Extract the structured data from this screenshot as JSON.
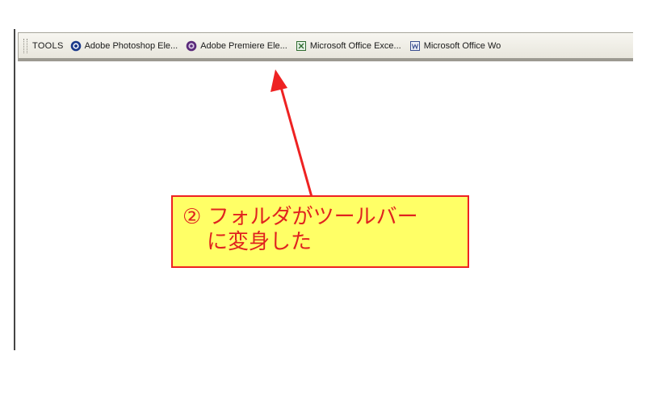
{
  "toolbar": {
    "label": "TOOLS",
    "items": [
      {
        "label": "Adobe Photoshop Ele...",
        "icon": "photoshop-elements-icon"
      },
      {
        "label": "Adobe Premiere Ele...",
        "icon": "premiere-elements-icon"
      },
      {
        "label": "Microsoft Office Exce...",
        "icon": "excel-icon"
      },
      {
        "label": "Microsoft Office Wo",
        "icon": "word-icon"
      }
    ]
  },
  "callout": {
    "line1": "② フォルダがツールバー",
    "line2": "に変身した"
  },
  "colors": {
    "callout_bg": "#ffff66",
    "callout_border": "#ee2222",
    "callout_text": "#e0231f",
    "arrow": "#ee2222"
  }
}
